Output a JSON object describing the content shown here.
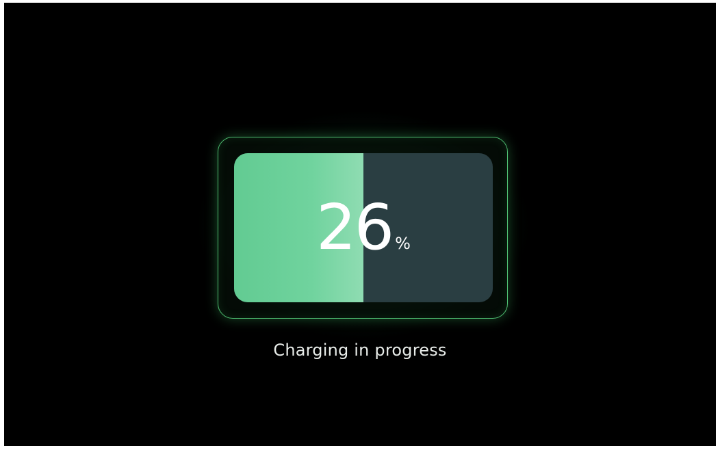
{
  "charging": {
    "level_value": "26",
    "level_unit": "%",
    "level_percent": 50,
    "status_text": "Charging in progress"
  },
  "colors": {
    "background": "#000000",
    "fill": "#6fd19d",
    "empty": "#2a3e42",
    "frame": "#4fbf72",
    "text": "#ffffff"
  },
  "icons": [
    "battery-icon"
  ]
}
